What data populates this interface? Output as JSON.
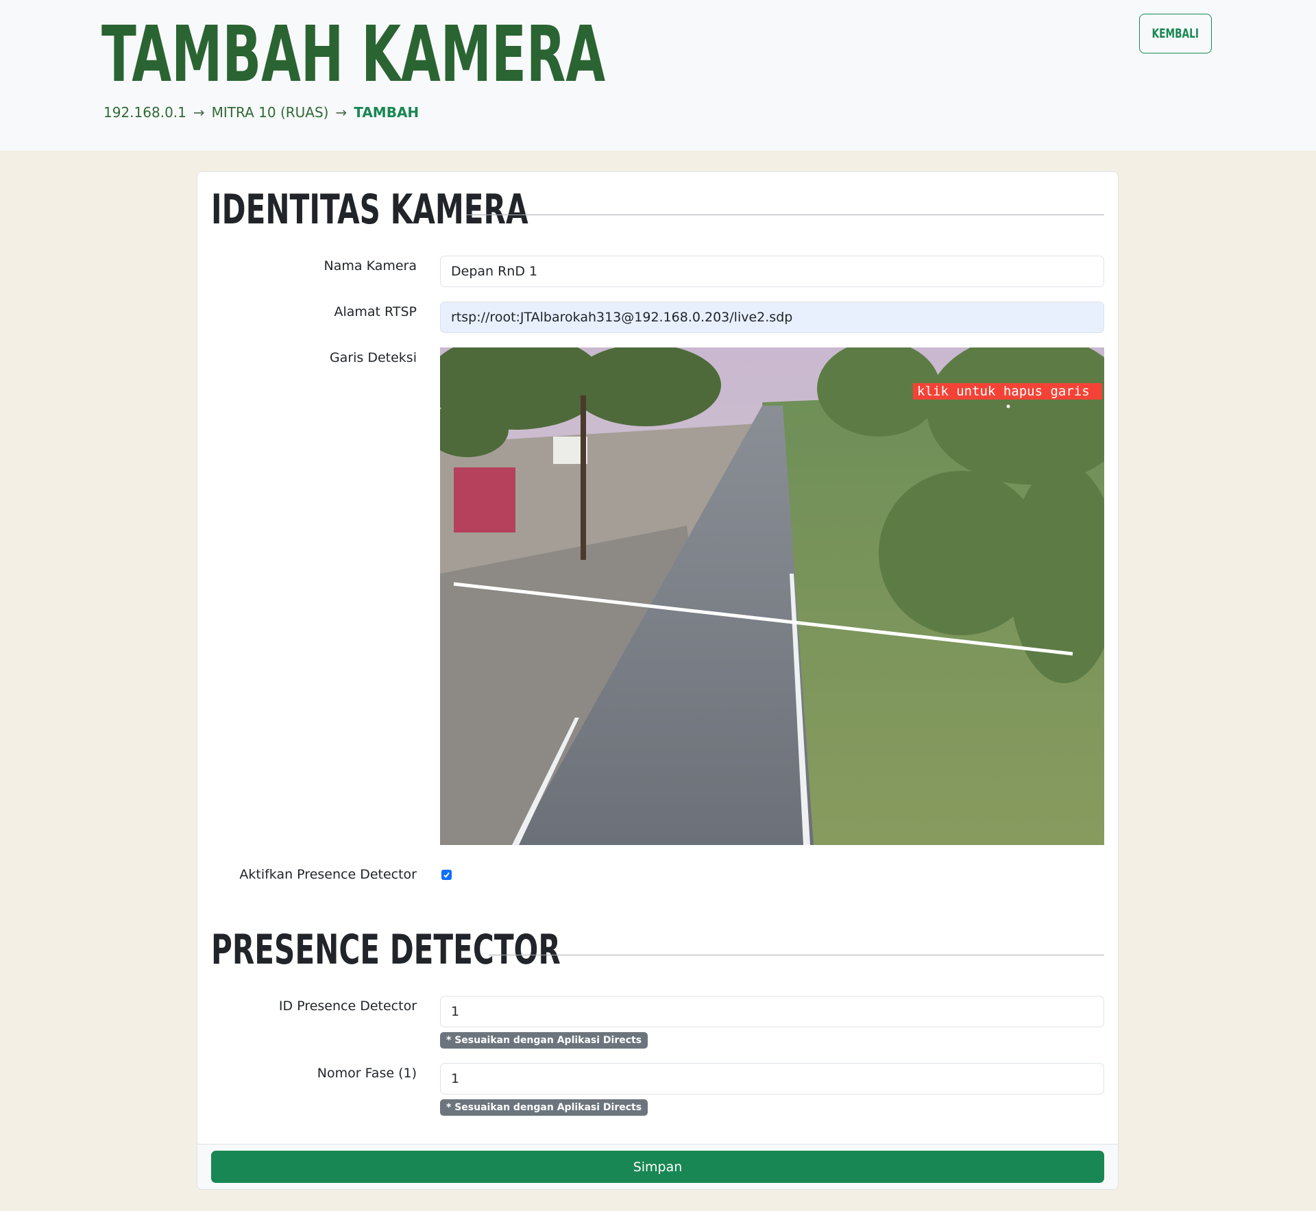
{
  "header": {
    "title": "TAMBAH KAMERA",
    "breadcrumb": [
      "192.168.0.1",
      "MITRA 10 (RUAS)",
      "TAMBAH"
    ],
    "arrow": "→",
    "back_label": "KEMBALI"
  },
  "identity_section": {
    "title": "IDENTITAS KAMERA",
    "fields": {
      "camera_name": {
        "label": "Nama Kamera",
        "value": "Depan RnD 1"
      },
      "rtsp_address": {
        "label": "Alamat RTSP",
        "value": "rtsp://root:JTAlbarokah313@192.168.0.203/live2.sdp"
      },
      "detection_line": {
        "label": "Garis Deteksi",
        "overlay_text": "klik untuk hapus garis"
      },
      "presence_enabled": {
        "label": "Aktifkan Presence Detector",
        "checked": true
      }
    }
  },
  "presence_section": {
    "title": "PRESENCE DETECTOR",
    "fields": {
      "presence_id": {
        "label": "ID Presence Detector",
        "value": "1",
        "hint": "* Sesuaikan dengan Aplikasi Directs"
      },
      "phase_number": {
        "label": "Nomor Fase (1)",
        "value": "1",
        "hint": "* Sesuaikan dengan Aplikasi Directs"
      }
    }
  },
  "actions": {
    "save_label": "Simpan"
  },
  "colors": {
    "brand_green": "#2a6432",
    "button_green": "#198754",
    "page_background": "#f4efe4",
    "overlay_red": "#f44336"
  },
  "icons": {
    "checkbox": "checkmark-icon"
  }
}
